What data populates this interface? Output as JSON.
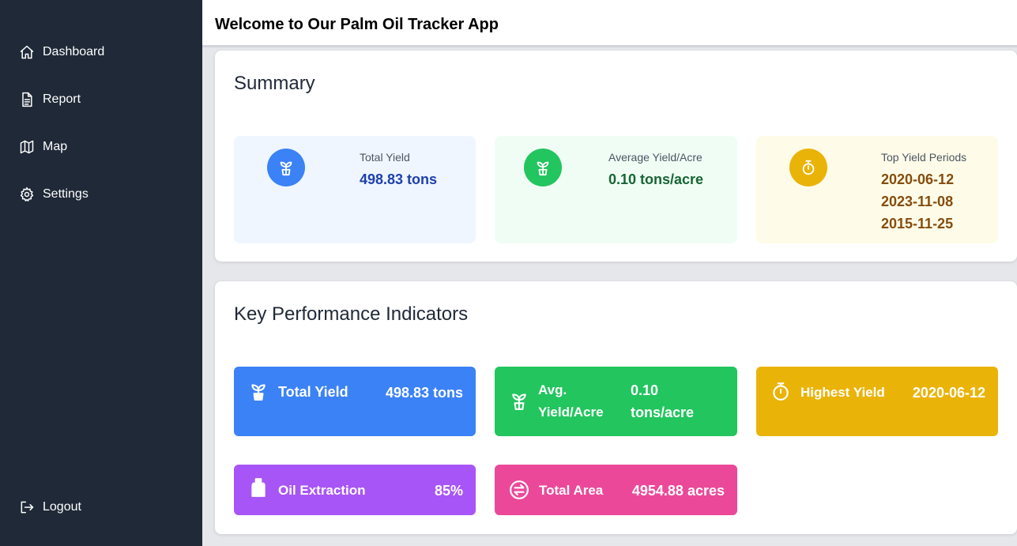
{
  "app": {
    "title": "Welcome to Our Palm Oil Tracker App"
  },
  "sidebar": {
    "items": [
      {
        "label": "Dashboard",
        "icon": "home-icon"
      },
      {
        "label": "Report",
        "icon": "document-icon"
      },
      {
        "label": "Map",
        "icon": "map-icon"
      },
      {
        "label": "Settings",
        "icon": "gear-icon"
      }
    ],
    "logout": {
      "label": "Logout",
      "icon": "logout-icon"
    }
  },
  "summary": {
    "title": "Summary",
    "total_yield": {
      "label": "Total Yield",
      "value": "498.83 tons",
      "icon": "sprout-icon",
      "color": "#3b82f6"
    },
    "avg_yield": {
      "label": "Average Yield/Acre",
      "value": "0.10 tons/acre",
      "icon": "sprout-icon",
      "color": "#22c55e"
    },
    "top_periods": {
      "label": "Top Yield Periods",
      "values": [
        "2020-06-12",
        "2023-11-08",
        "2015-11-25"
      ],
      "icon": "timer-icon",
      "color": "#eab308"
    }
  },
  "kpi": {
    "title": "Key Performance Indicators",
    "total_yield": {
      "label": "Total Yield",
      "value": "498.83 tons",
      "color": "#3b82f6"
    },
    "avg_yield": {
      "label_line1": "Avg.",
      "label_line2": "Yield/Acre",
      "value_line1": "0.10",
      "value_line2": "tons/acre",
      "color": "#22c55e"
    },
    "highest_yield": {
      "label": "Highest Yield",
      "value": "2020-06-12",
      "color": "#eab308"
    },
    "oil_extraction": {
      "label": "Oil Extraction",
      "value": "85%",
      "color": "#a855f7"
    },
    "total_area": {
      "label": "Total Area",
      "value": "4954.88 acres",
      "color": "#ec4899"
    }
  }
}
